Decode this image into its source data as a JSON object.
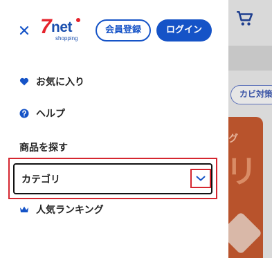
{
  "background": {
    "chip_label": "カビ対策",
    "banner_text": "グ",
    "banner_big": "リ"
  },
  "header": {
    "logo_number": "7",
    "logo_brand": "net",
    "logo_sub": "shopping",
    "register_label": "会員登録",
    "login_label": "ログイン"
  },
  "menu": {
    "favorites_label": "お気に入り",
    "help_label": "ヘルプ",
    "ranking_label": "人気ランキング"
  },
  "product_search": {
    "section_title": "商品を探す",
    "category_label": "カテゴリ"
  },
  "colors": {
    "brand_blue": "#1553c7",
    "brand_red": "#e5232c",
    "highlight_red": "#d5262f"
  },
  "icons": {
    "close": "close-icon",
    "heart": "heart-icon",
    "help": "question-circle-icon",
    "crown": "crown-icon",
    "chevron": "chevron-down-icon",
    "cart": "cart-icon"
  }
}
